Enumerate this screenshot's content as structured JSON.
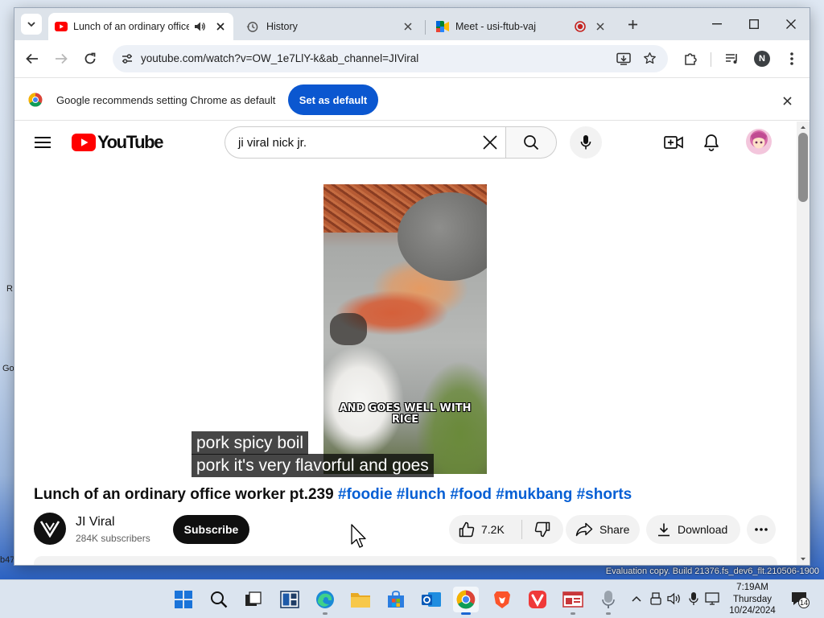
{
  "desktop": {
    "left_fragments": [
      "R",
      "Go",
      "b47"
    ],
    "evaluation_text": "Evaluation copy. Build 21376.fs_dev6_flt.210506-1900"
  },
  "browser": {
    "tabs": [
      {
        "title": "Lunch of an ordinary office",
        "icon": "youtube-favicon",
        "active": true,
        "audio": true
      },
      {
        "title": "History",
        "icon": "history-icon",
        "active": false
      },
      {
        "title": "Meet - usi-ftub-vaj",
        "icon": "meet-favicon",
        "active": false,
        "recording": true
      }
    ],
    "url": "youtube.com/watch?v=OW_1e7LlY-k&ab_channel=JIViral",
    "profile_initial": "N",
    "infobar": {
      "message": "Google recommends setting Chrome as default",
      "button": "Set as default"
    }
  },
  "youtube": {
    "logo_text": "YouTube",
    "search_query": "ji viral nick jr.",
    "video": {
      "burned_caption_line1": "AND GOES WELL WITH",
      "burned_caption_line2": "RICE"
    },
    "subtitles": [
      "pork spicy boil",
      "pork it's very flavorful and goes"
    ],
    "title": "Lunch of an ordinary office worker pt.239",
    "hashtags": "#foodie #lunch #food #mukbang #shorts",
    "channel": {
      "name": "JI Viral",
      "subscribers": "284K subscribers"
    },
    "subscribe_label": "Subscribe",
    "likes": "7.2K",
    "share_label": "Share",
    "download_label": "Download"
  },
  "taskbar": {
    "time": "7:19AM",
    "day": "Thursday",
    "date": "10/24/2024",
    "notification_count": "14"
  },
  "colors": {
    "youtube_red": "#ff0000",
    "link_blue": "#065fd4",
    "chrome_blue": "#0b57d0"
  }
}
